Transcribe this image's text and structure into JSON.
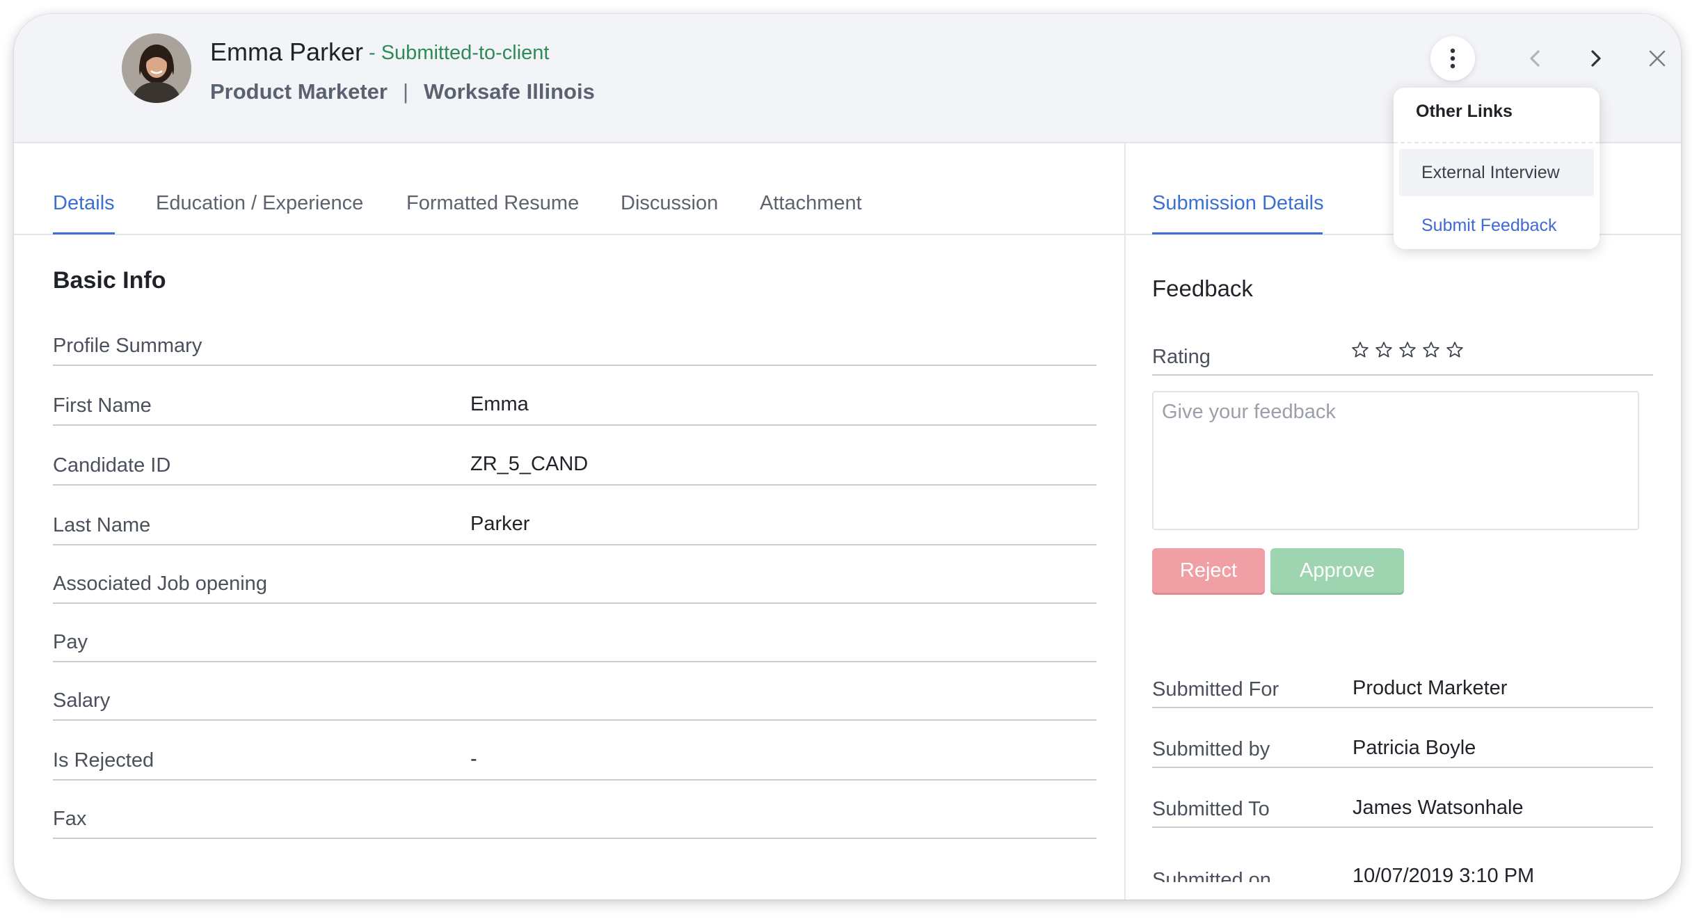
{
  "candidate": {
    "name": "Emma Parker",
    "status": "- Submitted-to-client",
    "title": "Product Marketer",
    "separator": "|",
    "company": "Worksafe Illinois"
  },
  "menu": {
    "title": "Other Links",
    "items": [
      "External Interview",
      "Submit Feedback"
    ]
  },
  "tabs": [
    "Details",
    "Education / Experience",
    "Formatted Resume",
    "Discussion",
    "Attachment"
  ],
  "active_tab": "Details",
  "right_tab": "Submission Details",
  "basic_info": {
    "title": "Basic Info",
    "rows": [
      {
        "label": "Profile Summary",
        "value": ""
      },
      {
        "label": "First Name",
        "value": "Emma"
      },
      {
        "label": "Candidate ID",
        "value": "ZR_5_CAND"
      },
      {
        "label": "Last Name",
        "value": "Parker"
      },
      {
        "label": "Associated Job opening",
        "value": ""
      },
      {
        "label": "Pay",
        "value": ""
      },
      {
        "label": "Salary",
        "value": ""
      },
      {
        "label": "Is Rejected",
        "value": "-"
      },
      {
        "label": "Fax",
        "value": ""
      }
    ]
  },
  "feedback": {
    "title": "Feedback",
    "rating_label": "Rating",
    "rating_value": 0,
    "rating_max": 5,
    "placeholder": "Give your feedback",
    "reject_label": "Reject",
    "approve_label": "Approve"
  },
  "submission": {
    "rows": [
      {
        "label": "Submitted For",
        "value": "Product Marketer"
      },
      {
        "label": "Submitted by",
        "value": "Patricia Boyle"
      },
      {
        "label": "Submitted To",
        "value": "James Watsonhale"
      },
      {
        "label": "Submitted on",
        "value": "10/07/2019 3:10 PM"
      }
    ]
  },
  "colors": {
    "status_green": "#2e8b57",
    "accent_blue": "#3b6fd1",
    "reject": "#f0a0a4",
    "approve": "#9ed4b0",
    "header_bg": "#f3f4f8"
  },
  "icons": [
    "avatar-photo",
    "more-vertical-icon",
    "chevron-left-icon",
    "chevron-right-icon",
    "close-icon",
    "star-outline-icon"
  ]
}
